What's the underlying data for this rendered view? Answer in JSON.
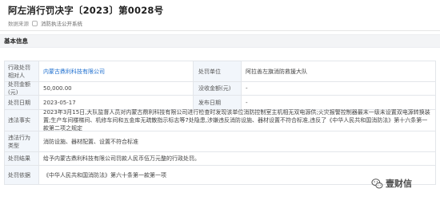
{
  "header": {
    "title": "阿左消行罚决字〔2023〕第0028号",
    "source_label": "数据来源",
    "source_value": "消防执法公开系统"
  },
  "section": {
    "title": "基本信息"
  },
  "rows": {
    "party_label": "行政处罚相对人",
    "party_value": "内蒙古鼎利科技有限公司",
    "unit_label": "处罚单位",
    "unit_value": "阿拉善左旗消防救援大队",
    "amount_label": "处罚金额(元)",
    "amount_value": "50,000.00",
    "confiscated_label": "没收金额(元)",
    "confiscated_value": "-",
    "date_label": "处罚日期",
    "date_value": "2023-05-17",
    "publish_label": "发布日期",
    "publish_value": "-",
    "facts_label": "违法事实",
    "facts_value": "2023年3月15日,大队监督人员对内蒙古鼎利科技有限公司进行检查时发现该单位消防控制室主机相无双电源供;火灾报警控制器最末一级未设置双电源转换装置;生产车间楼梯间、机修车间和五金库无疏散指示标志等7处隐患,涉嫌违反消防设施、器材设置不符合标准,违反了《中华人民共和国消防法》第十六条第一款第二项之规定",
    "category_label": "违法行为类型",
    "category_value": "消防设施、器材配置、设置不符合标准",
    "result_label": "处罚结果",
    "result_value": "给予内蒙古鼎利科技有限公司罚款人民币伍万元整的行政处罚。",
    "basis_label": "处罚依据",
    "basis_value": "《中华人民共和国消防法》第六十条第一款第一项"
  },
  "watermark": {
    "text": "壹财信",
    "icon": "wechat-icon"
  },
  "colors": {
    "link": "#1e6fcf",
    "label_bg": "#f2f6fb",
    "section_bg": "#f3f4f6"
  }
}
